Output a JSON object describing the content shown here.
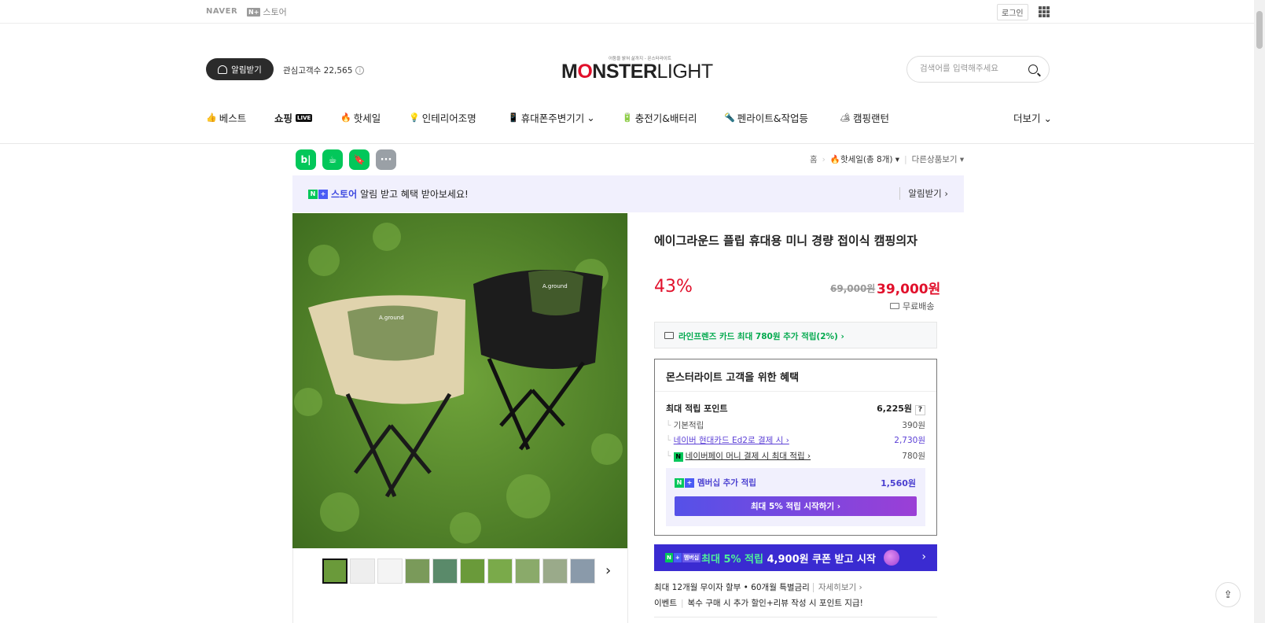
{
  "gnb": {
    "naver": "NAVER",
    "nplus": "N+",
    "store": "스토어",
    "login": "로그인"
  },
  "header": {
    "alarm_button": "알림받기",
    "interest_label": "관심고객수 22,565",
    "info_icon": "i",
    "logo_tagline": "어둠을 밝혀 삶까지 - 몬스터라이트",
    "logo_bold_1": "M",
    "logo_bold_2": "NSTER",
    "logo_light": "LIGHT",
    "search_placeholder": "검색어를 입력해주세요"
  },
  "categories": [
    {
      "emoji": "👍",
      "label": "베스트"
    },
    {
      "emoji": "",
      "label": "쇼핑",
      "badge": "LIVE"
    },
    {
      "emoji": "🔥",
      "label": "핫세일"
    },
    {
      "emoji": "💡",
      "label": "인테리어조명"
    },
    {
      "emoji": "📱",
      "label": "휴대폰주변기기",
      "caret": "⌄"
    },
    {
      "emoji": "🔋",
      "label": "충전기&배터리"
    },
    {
      "emoji": "🔦",
      "label": "펜라이트&작업등"
    },
    {
      "emoji": "🏕",
      "label": "캠핑랜턴"
    }
  ],
  "more": "더보기 ⌄",
  "share_icons": [
    "b|",
    "☕",
    "🔖",
    "···"
  ],
  "breadcrumb": {
    "home": "홈",
    "current": "🔥핫세일(총 8개) ▾",
    "other": "다른상품보기 ▾"
  },
  "banner": {
    "store": "스토어",
    "text": "알림 받고 혜택 받아보세요!",
    "action": "알림받기 ›"
  },
  "product": {
    "title": "에이그라운드 플립 휴대용 미니 경량 접이식 캠핑의자",
    "discount": "43%",
    "original_price": "69,000원",
    "sale_price": "39,000원",
    "shipping": "무료배송",
    "image_brand": "A.ground"
  },
  "card_offer": "라인프렌즈 카드 최대 780원 추가 적립(2%) ›",
  "benefit": {
    "heading": "몬스터라이트 고객을 위한 혜택",
    "max_points_label": "최대 적립 포인트",
    "max_points_value": "6,225원",
    "qmark": "?",
    "rows": [
      {
        "label": "기본적립",
        "value": "390원"
      },
      {
        "label": "네이버 현대카드 Ed2로 결제 시 ›",
        "value": "2,730원"
      },
      {
        "label": "네이버페이 머니 결제 시 최대 적립 ›",
        "value": "780원"
      }
    ],
    "npay_icon": "N",
    "membership_label": "멤버십 추가 적립",
    "membership_value": "1,560원",
    "membership_button": "최대 5% 적립 시작하기 ›"
  },
  "coupon": {
    "badge": "멤버십",
    "highlight": "최대 5% 적립",
    "text": " 4,900원 쿠폰 받고 시작",
    "arrow": "›"
  },
  "installment": {
    "text": "최대 12개월 무이자 할부 • 60개월 특별금리",
    "link": "자세히보기 ›"
  },
  "event": {
    "label": "이벤트",
    "text": "복수 구매 시 추가 할인+리뷰 작성 시 포인트 지급!"
  },
  "thumbs_next": "›",
  "float_share": "⇪"
}
